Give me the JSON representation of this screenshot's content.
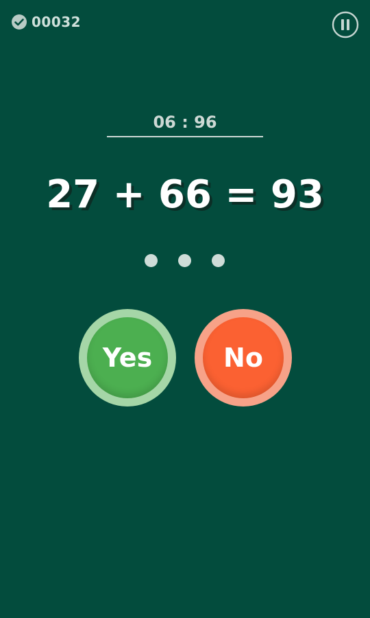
{
  "header": {
    "score": "00032",
    "score_icon": "check-circle-icon",
    "pause_icon": "pause-icon"
  },
  "game": {
    "timer": "06 : 96",
    "equation": "27 + 66 = 93",
    "progress_dots": 3
  },
  "buttons": {
    "yes_label": "Yes",
    "no_label": "No"
  },
  "colors": {
    "background": "#034c3d",
    "yes": "#4caf50",
    "yes_ring": "#a5d6a7",
    "no": "#fb6132",
    "no_ring": "#f7a288",
    "muted_text": "#cdd9d5"
  }
}
